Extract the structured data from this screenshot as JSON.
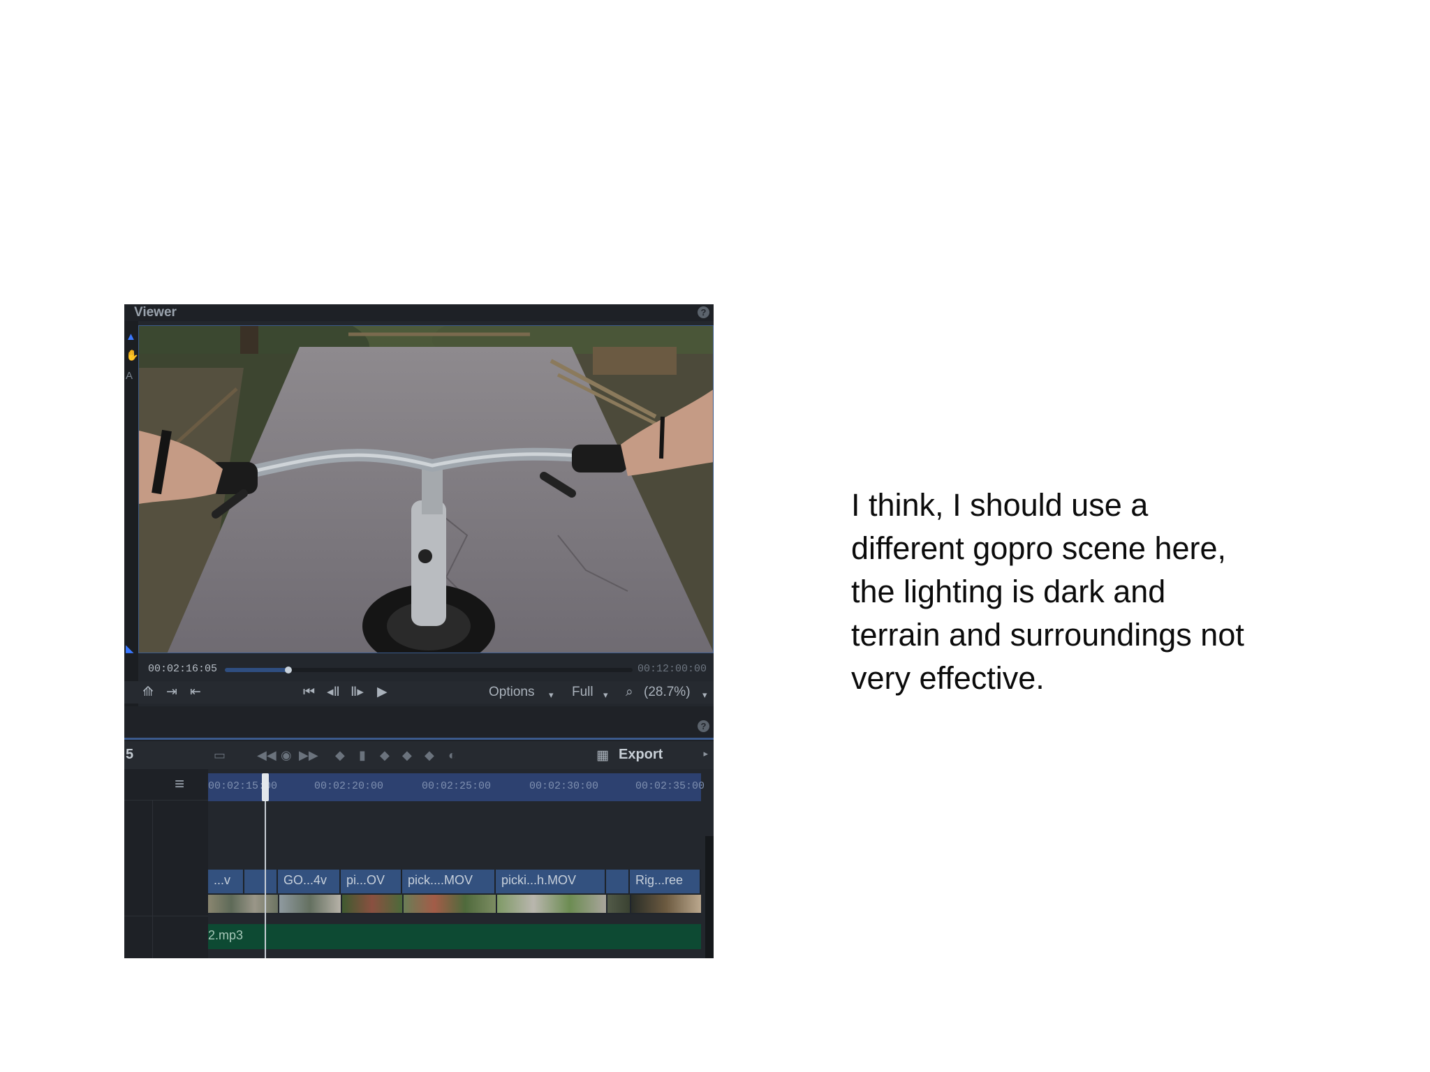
{
  "viewer": {
    "title": "Viewer",
    "help_label": "?",
    "video_description_icon": "bike-handlebar-pov-frame",
    "timecode_current": "00:02:16:05",
    "timecode_total": "00:12:00:00",
    "scrub_progress": 0.155,
    "transport": {
      "crop_icon": "⟰",
      "export_frame_icon": "⇥",
      "import_icon": "⇤",
      "go_start_icon": "⏮",
      "step_back_icon": "◂Ⅱ",
      "step_forward_icon": "Ⅱ▸",
      "play_icon": "▶",
      "options_label": "Options",
      "quality_label": "Full",
      "zoom_label": "(28.7%)",
      "dropdown_glyph": "▾",
      "zoom_icon": "⌕"
    }
  },
  "timeline": {
    "help_label": "?",
    "track_number": "5",
    "export_label": "Export",
    "export_icon": "▦",
    "export_arrow": "▸",
    "hamburger_icon": "≡",
    "ruler_ticks": [
      "00:02:15:00",
      "00:02:20:00",
      "00:02:25:00",
      "00:02:30:00",
      "00:02:35:00"
    ],
    "clips": [
      "...v",
      "",
      "GO...4v",
      "pi...OV",
      "pick....MOV",
      "picki...h.MOV",
      "",
      "Rig...ree"
    ],
    "audio_clip": "2.mp3",
    "keyframe_icons": [
      "◀◀",
      "◉",
      "▶▶",
      "◆",
      "▮",
      "◆",
      "◆",
      "◆",
      "◐"
    ]
  },
  "commentary": {
    "lines": [
      "I think, I should use a",
      "different gopro scene here,",
      "the lighting is dark and",
      "terrain and surroundings not",
      "very effective."
    ]
  },
  "colors": {
    "panel_bg": "#23272d",
    "accent_blue": "#3b5a8c",
    "clip_blue": "#33517f",
    "audio_green": "#0d4a33",
    "text_black": "#0b0b0b"
  }
}
